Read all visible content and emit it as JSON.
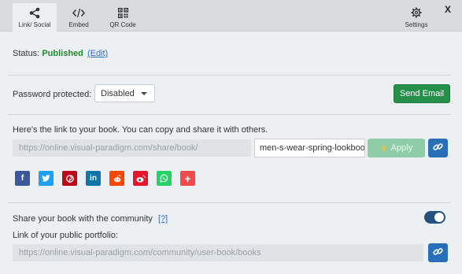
{
  "toolbar": {
    "tabs": [
      {
        "label": "Link/ Social",
        "icon": "share-icon",
        "active": true
      },
      {
        "label": "Embed",
        "icon": "code-icon"
      },
      {
        "label": "QR Code",
        "icon": "qr-code-icon"
      }
    ],
    "settings_label": "Settings",
    "close_label": "X"
  },
  "status": {
    "label": "Status:",
    "value": "Published",
    "edit_label": "(Edit)",
    "value_color": "#1f8a2d"
  },
  "password": {
    "label": "Password protected:",
    "selected": "Disabled"
  },
  "send_email_label": "Send Email",
  "share": {
    "text": "Here's the link to your book. You can copy and share it with others.",
    "base_url": "https://online.visual-paradigm.com/share/book/",
    "slug": "men-s-wear-spring-lookbook",
    "apply_label": "Apply",
    "socials": [
      {
        "name": "facebook-icon",
        "glyph": "f",
        "color": "#3b5998"
      },
      {
        "name": "twitter-icon",
        "glyph": "t",
        "color": "#1da1f2"
      },
      {
        "name": "pinterest-icon",
        "glyph": "P",
        "color": "#bd081c"
      },
      {
        "name": "linkedin-icon",
        "glyph": "in",
        "color": "#0e76a8"
      },
      {
        "name": "reddit-icon",
        "glyph": "r",
        "color": "#ff4500"
      },
      {
        "name": "weibo-icon",
        "glyph": "w",
        "color": "#e6162d"
      },
      {
        "name": "whatsapp-icon",
        "glyph": "w",
        "color": "#25d366"
      },
      {
        "name": "more-share-icon",
        "glyph": "+",
        "color": "#f14b4b"
      }
    ]
  },
  "community": {
    "label": "Share your book with the community",
    "help_label": "[?]",
    "enabled": true,
    "portfolio_label": "Link of your public portfolio:",
    "portfolio_url": "https://online.visual-paradigm.com/community/user-book/books"
  }
}
